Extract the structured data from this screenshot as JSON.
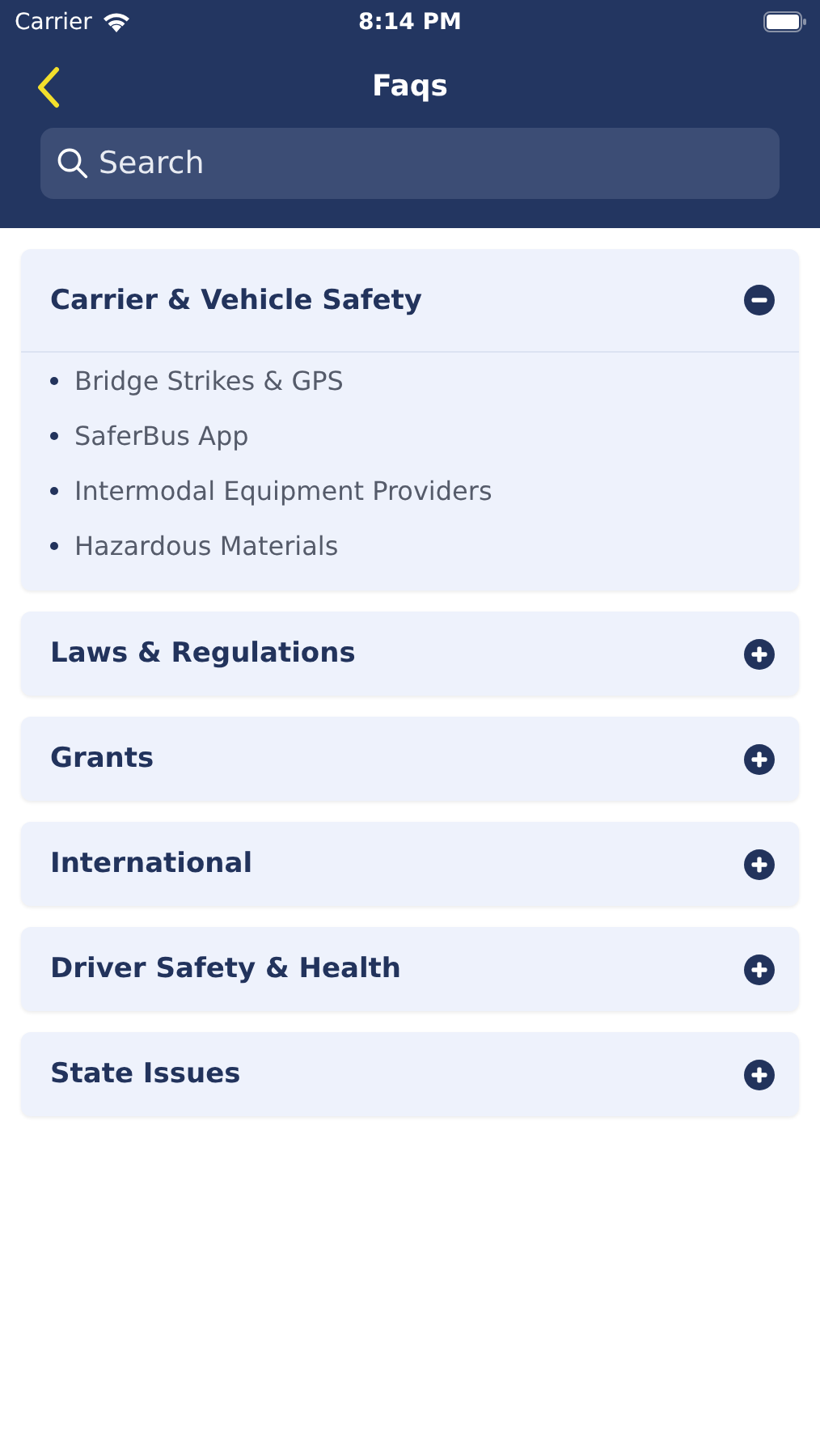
{
  "status_bar": {
    "carrier": "Carrier",
    "time": "8:14 PM"
  },
  "nav": {
    "title": "Faqs"
  },
  "search": {
    "placeholder": "Search"
  },
  "sections": [
    {
      "title": "Carrier & Vehicle Safety",
      "expanded": true,
      "items": [
        "Bridge Strikes & GPS",
        "SaferBus App",
        "Intermodal Equipment Providers",
        "Hazardous Materials"
      ]
    },
    {
      "title": "Laws & Regulations",
      "expanded": false
    },
    {
      "title": "Grants",
      "expanded": false
    },
    {
      "title": "International",
      "expanded": false
    },
    {
      "title": "Driver Safety & Health",
      "expanded": false
    },
    {
      "title": "State Issues",
      "expanded": false
    }
  ]
}
